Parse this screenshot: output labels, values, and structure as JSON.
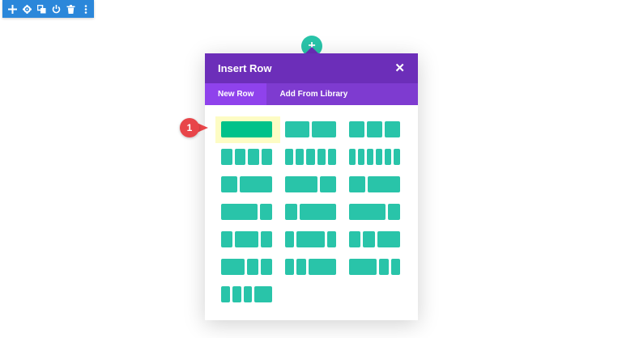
{
  "toolbar": {
    "icons": [
      "move-icon",
      "settings-icon",
      "duplicate-icon",
      "toggle-icon",
      "delete-icon",
      "more-icon"
    ],
    "color": "#2b87da"
  },
  "modal": {
    "title": "Insert Row",
    "close_label": "✕",
    "header_color": "#6c2eb9",
    "tabs": [
      {
        "label": "New Row",
        "active": true
      },
      {
        "label": "Add From Library",
        "active": false
      }
    ]
  },
  "layouts": [
    [
      1
    ],
    [
      1,
      1
    ],
    [
      1,
      1,
      1
    ],
    [
      1,
      1,
      1,
      1
    ],
    [
      1,
      1,
      1,
      1,
      1
    ],
    [
      1,
      1,
      1,
      1,
      1,
      1
    ],
    [
      1,
      2
    ],
    [
      2,
      1
    ],
    [
      1,
      2
    ],
    [
      3,
      1
    ],
    [
      1,
      3
    ],
    [
      3,
      1
    ],
    [
      1,
      2,
      1
    ],
    [
      1,
      3,
      1
    ],
    [
      1,
      1,
      2
    ],
    [
      2,
      1,
      1
    ],
    [
      1,
      1,
      3
    ],
    [
      3,
      1,
      1
    ],
    [
      1,
      1,
      1,
      2
    ]
  ],
  "layout_color": "#29c4a9",
  "callout": {
    "number": "1",
    "color": "#e84549"
  }
}
